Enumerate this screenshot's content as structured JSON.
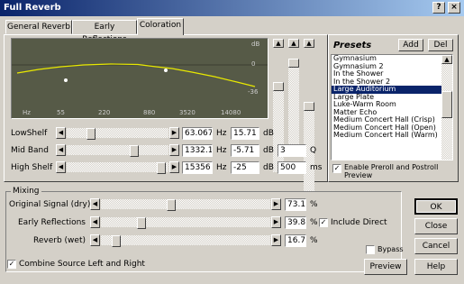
{
  "window": {
    "title": "Full Reverb",
    "close": "×",
    "help": "?"
  },
  "tabs": [
    {
      "label": "General Reverb"
    },
    {
      "label": "Early Reflections"
    },
    {
      "label": "Coloration"
    }
  ],
  "graph": {
    "db_top": "dB",
    "db_zero": "0",
    "db_bottom": "-36",
    "freq_labels": [
      "Hz",
      "55",
      "220",
      "880",
      "3520",
      "14080"
    ]
  },
  "eq": [
    {
      "label": "LowShelf",
      "freq": "63.067",
      "freq_unit": "Hz",
      "gain": "15.71",
      "gain_unit": "dB"
    },
    {
      "label": "Mid Band",
      "freq": "1332.1",
      "freq_unit": "Hz",
      "gain": "-5.71",
      "gain_unit": "dB",
      "q": "3",
      "q_unit": "Q"
    },
    {
      "label": "High Shelf",
      "freq": "15356",
      "freq_unit": "Hz",
      "gain": "-25",
      "gain_unit": "dB",
      "ms": "500",
      "ms_unit": "ms"
    }
  ],
  "presets": {
    "title": "Presets",
    "add": "Add",
    "del": "Del",
    "items": [
      "Gymnasium",
      "Gymnasium 2",
      "In the Shower",
      "In the Shower 2",
      "Large Auditorium",
      "Large Plate",
      "Luke-Warm Room",
      "Matter Echo",
      "Medium Concert Hall (Crisp)",
      "Medium Concert Hall (Open)",
      "Medium Concert Hall (Warm)"
    ],
    "selected": "Large Auditorium",
    "enable_preroll": "Enable Preroll and Postroll Preview",
    "enable_preroll_checked": true
  },
  "mixing": {
    "title": "Mixing",
    "rows": [
      {
        "label": "Original Signal (dry)",
        "value": "73.1",
        "unit": "%",
        "level": 0.73
      },
      {
        "label": "Early Reflections",
        "value": "39.8",
        "unit": "%",
        "level": 0.4
      },
      {
        "label": "Reverb (wet)",
        "value": "16.7",
        "unit": "%",
        "level": 0.17
      }
    ],
    "include_direct": "Include Direct",
    "include_direct_checked": true,
    "combine": "Combine Source Left and Right",
    "combine_checked": true,
    "bypass": "Bypass",
    "bypass_checked": false
  },
  "buttons": {
    "ok": "OK",
    "close": "Close",
    "cancel": "Cancel",
    "preview": "Preview",
    "help": "Help"
  }
}
